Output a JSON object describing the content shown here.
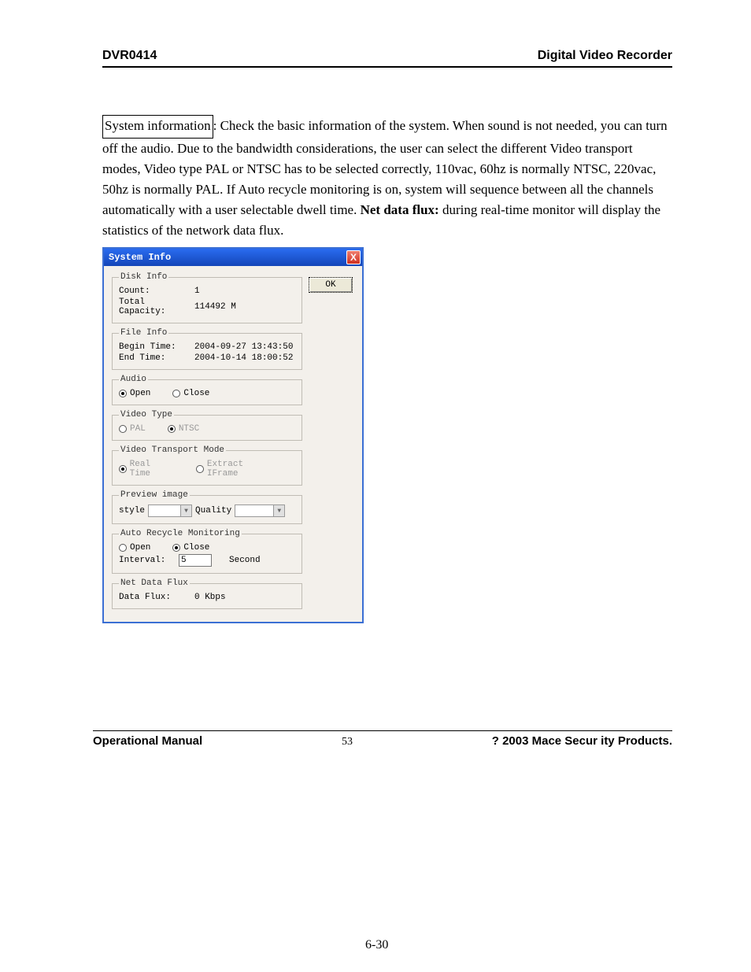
{
  "header": {
    "left": "DVR0414",
    "right": "Digital Video Recorder"
  },
  "para": {
    "sys_label": "System information",
    "colon_sep": ": ",
    "t1": "  Check the basic information of the system. When sound is not needed, you can turn off the audio. Due to the bandwidth considerations, the user can select the different Video transport modes, Video type PAL or NTSC has to be selected correctly, 110vac, 60hz is normally NTSC, 220vac, 50hz is normally PAL. If Auto recycle monitoring is on, system will sequence between all the channels automatically with a user selectable dwell time. ",
    "bold": "Net data flux:",
    "t2": " during real-time monitor will display the statistics of the network data flux."
  },
  "dialog": {
    "title": "System Info",
    "close": "X",
    "ok": "OK",
    "disk": {
      "legend": "Disk Info",
      "count_l": "Count:",
      "count_v": "1",
      "cap_l": "Total Capacity:",
      "cap_v": "114492 M"
    },
    "file": {
      "legend": "File Info",
      "begin_l": "Begin Time:",
      "begin_v": "2004-09-27  13:43:50",
      "end_l": "End Time:",
      "end_v": "2004-10-14  18:00:52"
    },
    "audio": {
      "legend": "Audio",
      "open": "Open",
      "close": "Close"
    },
    "vtype": {
      "legend": "Video Type",
      "pal": "PAL",
      "ntsc": "NTSC"
    },
    "vtrans": {
      "legend": "Video Transport Mode",
      "rt": "Real Time",
      "ef": "Extract IFrame"
    },
    "preview": {
      "legend": "Preview image",
      "style_l": "style",
      "quality_l": "Quality"
    },
    "recycle": {
      "legend": "Auto Recycle Monitoring",
      "open": "Open",
      "close": "Close",
      "interval_l": "Interval:",
      "interval_v": "5",
      "second": "Second"
    },
    "flux": {
      "legend": "Net Data Flux",
      "label": "Data Flux:",
      "value": "0 Kbps"
    }
  },
  "figure_num": "6-30",
  "footer": {
    "left": "Operational Manual",
    "center": "53",
    "right": "? 2003 Mace Secur ity Products."
  }
}
